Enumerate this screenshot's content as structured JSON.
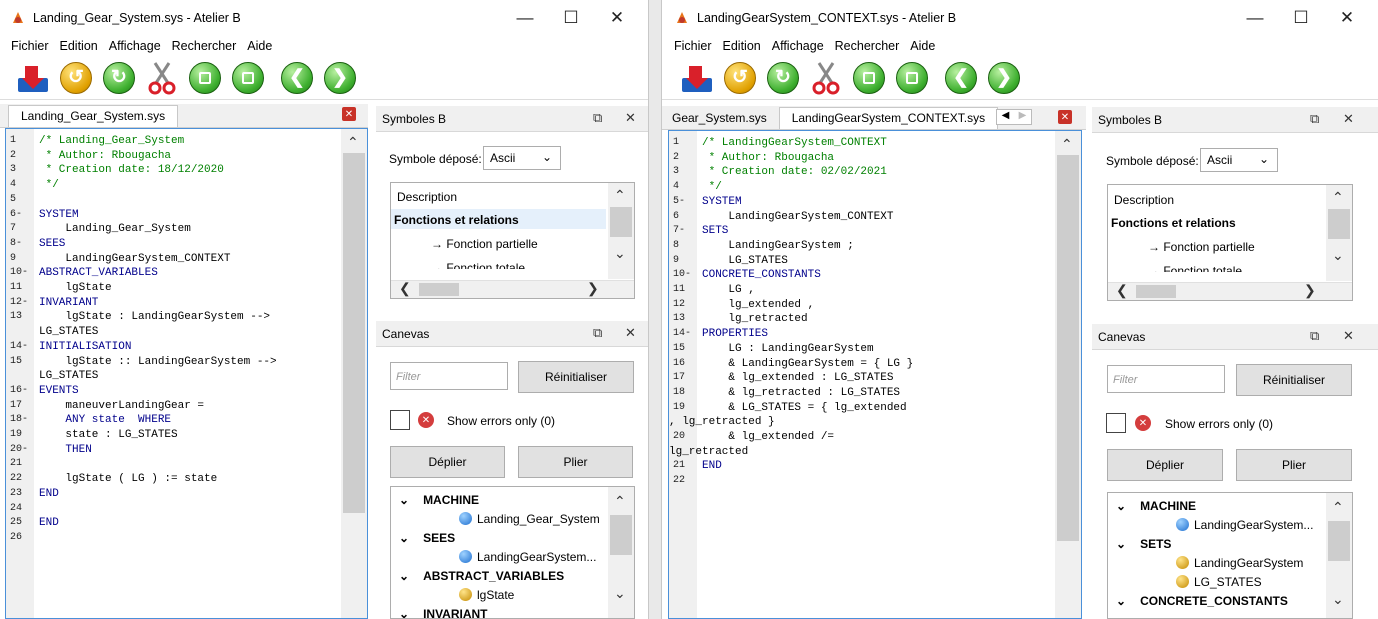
{
  "left": {
    "title": "Landing_Gear_System.sys - Atelier B",
    "menu": [
      "Fichier",
      "Edition",
      "Affichage",
      "Rechercher",
      "Aide"
    ],
    "tab": "Landing_Gear_System.sys",
    "lines": [
      {
        "n": "1",
        "t": "/* Landing_Gear_System",
        "c": "cm"
      },
      {
        "n": "2",
        "t": " * Author: Rbougacha",
        "c": "cm"
      },
      {
        "n": "3",
        "t": " * Creation date: 18/12/2020",
        "c": "cm"
      },
      {
        "n": "4",
        "t": " */",
        "c": "cm"
      },
      {
        "n": "5",
        "t": "",
        "c": ""
      },
      {
        "n": "6-",
        "t": "SYSTEM",
        "c": "kw"
      },
      {
        "n": "7",
        "t": "    Landing_Gear_System",
        "c": ""
      },
      {
        "n": "8-",
        "t": "SEES",
        "c": "kw"
      },
      {
        "n": "9",
        "t": "    LandingGearSystem_CONTEXT",
        "c": ""
      },
      {
        "n": "10-",
        "t": "ABSTRACT_VARIABLES",
        "c": "kw"
      },
      {
        "n": "11",
        "t": "    lgState",
        "c": ""
      },
      {
        "n": "12-",
        "t": "INVARIANT",
        "c": "kw"
      },
      {
        "n": "13",
        "t": "    lgState : LandingGearSystem -->",
        "c": ""
      },
      {
        "n": "",
        "t": "LG_STATES",
        "c": "",
        "wrap": true
      },
      {
        "n": "14-",
        "t": "INITIALISATION",
        "c": "kw"
      },
      {
        "n": "15",
        "t": "    lgState :: LandingGearSystem -->",
        "c": ""
      },
      {
        "n": "",
        "t": "LG_STATES",
        "c": "",
        "wrap": true
      },
      {
        "n": "16-",
        "t": "EVENTS",
        "c": "kw"
      },
      {
        "n": "17",
        "t": "    maneuverLandingGear =",
        "c": ""
      },
      {
        "n": "18-",
        "t": "    ANY state  WHERE",
        "c": "kw"
      },
      {
        "n": "19",
        "t": "    state : LG_STATES",
        "c": ""
      },
      {
        "n": "20-",
        "t": "    THEN",
        "c": "kw"
      },
      {
        "n": "21",
        "t": "",
        "c": ""
      },
      {
        "n": "22",
        "t": "    lgState ( LG ) := state",
        "c": ""
      },
      {
        "n": "23",
        "t": "END",
        "c": "kw"
      },
      {
        "n": "24",
        "t": "",
        "c": ""
      },
      {
        "n": "25",
        "t": "END",
        "c": "kw"
      },
      {
        "n": "26",
        "t": "",
        "c": ""
      }
    ],
    "symboles": {
      "header": "Symboles B",
      "depose_label": "Symbole déposé:",
      "depose_value": "Ascii",
      "list": [
        "Description",
        "Fonctions et relations",
        "→ Fonction partielle",
        "→ Fonction totale"
      ]
    },
    "canevas": {
      "header": "Canevas",
      "filter_placeholder": "Filter",
      "reset": "Réinitialiser",
      "show_errors": "Show errors only (0)",
      "deplier": "Déplier",
      "plier": "Plier",
      "tree": [
        {
          "kind": "section",
          "label": "MACHINE"
        },
        {
          "kind": "item",
          "label": "Landing_Gear_System",
          "icon": "blue"
        },
        {
          "kind": "section",
          "label": "SEES"
        },
        {
          "kind": "item",
          "label": "LandingGearSystem...",
          "icon": "blue"
        },
        {
          "kind": "section",
          "label": "ABSTRACT_VARIABLES"
        },
        {
          "kind": "item",
          "label": "lgState",
          "icon": "gold"
        },
        {
          "kind": "section",
          "label": "INVARIANT"
        }
      ]
    }
  },
  "right": {
    "title": "LandingGearSystem_CONTEXT.sys - Atelier B",
    "menu": [
      "Fichier",
      "Edition",
      "Affichage",
      "Rechercher",
      "Aide"
    ],
    "tab_prev": "Gear_System.sys",
    "tab": "LandingGearSystem_CONTEXT.sys",
    "lines": [
      {
        "n": "1",
        "t": "/* LandingGearSystem_CONTEXT",
        "c": "cm"
      },
      {
        "n": "2",
        "t": " * Author: Rbougacha",
        "c": "cm"
      },
      {
        "n": "3",
        "t": " * Creation date: 02/02/2021",
        "c": "cm"
      },
      {
        "n": "4",
        "t": " */",
        "c": "cm"
      },
      {
        "n": "5-",
        "t": "SYSTEM",
        "c": "kw"
      },
      {
        "n": "6",
        "t": "    LandingGearSystem_CONTEXT",
        "c": ""
      },
      {
        "n": "7-",
        "t": "SETS",
        "c": "kw"
      },
      {
        "n": "8",
        "t": "    LandingGearSystem ;",
        "c": ""
      },
      {
        "n": "9",
        "t": "    LG_STATES",
        "c": ""
      },
      {
        "n": "10-",
        "t": "CONCRETE_CONSTANTS",
        "c": "kw"
      },
      {
        "n": "11",
        "t": "    LG ,",
        "c": ""
      },
      {
        "n": "12",
        "t": "    lg_extended ,",
        "c": ""
      },
      {
        "n": "13",
        "t": "    lg_retracted",
        "c": ""
      },
      {
        "n": "14-",
        "t": "PROPERTIES",
        "c": "kw"
      },
      {
        "n": "15",
        "t": "    LG : LandingGearSystem",
        "c": ""
      },
      {
        "n": "16",
        "t": "    & LandingGearSystem = { LG }",
        "c": ""
      },
      {
        "n": "17",
        "t": "    & lg_extended : LG_STATES",
        "c": ""
      },
      {
        "n": "18",
        "t": "    & lg_retracted : LG_STATES",
        "c": ""
      },
      {
        "n": "19",
        "t": "    & LG_STATES = { lg_extended",
        "c": ""
      },
      {
        "n": "",
        "t": ", lg_retracted }",
        "c": "",
        "wrap": true
      },
      {
        "n": "20",
        "t": "    & lg_extended /=",
        "c": ""
      },
      {
        "n": "",
        "t": "lg_retracted",
        "c": "",
        "wrap": true
      },
      {
        "n": "21",
        "t": "END",
        "c": "kw"
      },
      {
        "n": "22",
        "t": "",
        "c": ""
      }
    ],
    "symboles": {
      "header": "Symboles B",
      "depose_label": "Symbole déposé:",
      "depose_value": "Ascii",
      "list": [
        "Description",
        "Fonctions et relations",
        "→ Fonction partielle",
        "→ Fonction totale"
      ]
    },
    "canevas": {
      "header": "Canevas",
      "filter_placeholder": "Filter",
      "reset": "Réinitialiser",
      "show_errors": "Show errors only (0)",
      "deplier": "Déplier",
      "plier": "Plier",
      "tree": [
        {
          "kind": "section",
          "label": "MACHINE"
        },
        {
          "kind": "item",
          "label": "LandingGearSystem...",
          "icon": "blue"
        },
        {
          "kind": "section",
          "label": "SETS"
        },
        {
          "kind": "item",
          "label": "LandingGearSystem",
          "icon": "gold"
        },
        {
          "kind": "item",
          "label": "LG_STATES",
          "icon": "gold"
        },
        {
          "kind": "section",
          "label": "CONCRETE_CONSTANTS"
        }
      ]
    }
  }
}
